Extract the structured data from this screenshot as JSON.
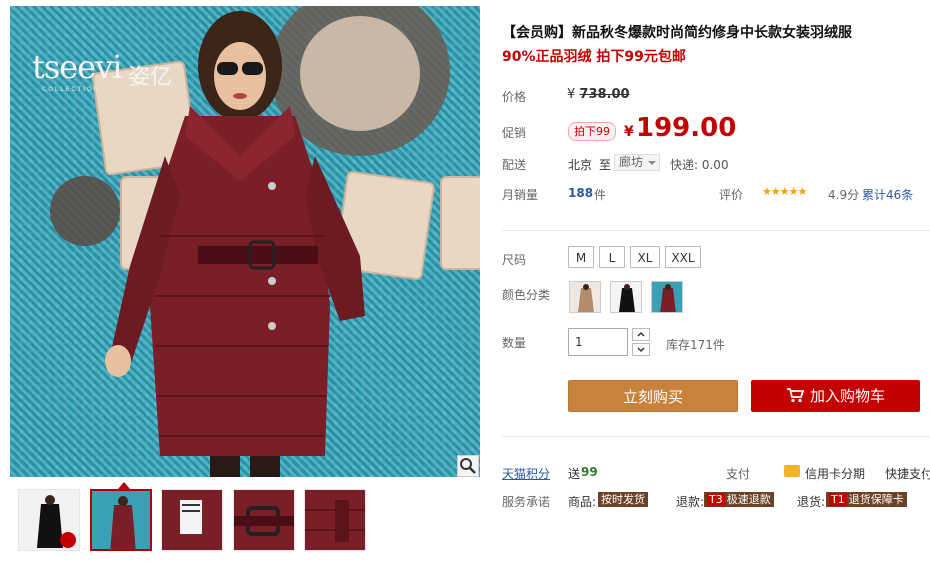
{
  "gallery": {
    "brand": "tseevi",
    "brand_cn": "姿亿",
    "brand_sub": "COLLECTION",
    "thumb_count": 5
  },
  "product": {
    "title": "【会员购】新品秋冬爆款时尚简约修身中长款女装羽绒服",
    "subtitle": "90%正品羽绒 拍下99元包邮"
  },
  "price": {
    "label": "价格",
    "original_symbol": "¥",
    "original": "738.00",
    "promo_label": "促销",
    "promo_tag": "拍下99",
    "symbol": "¥",
    "current": "199.00"
  },
  "shipping": {
    "label": "配送",
    "from": "北京",
    "to_word": "至",
    "city": "廊坊",
    "fee": "快递: 0.00"
  },
  "sales": {
    "label": "月销量",
    "count": "188",
    "unit": "件",
    "rating_label": "评价",
    "stars": "★★★★★",
    "score": "4.9分",
    "reviews": "累计46条"
  },
  "size": {
    "label": "尺码",
    "options": [
      "M",
      "L",
      "XL",
      "XXL"
    ]
  },
  "color": {
    "label": "颜色分类"
  },
  "quantity": {
    "label": "数量",
    "value": "1",
    "stock": "库存171件"
  },
  "actions": {
    "buy_now": "立刻购买",
    "add_cart": "加入购物车"
  },
  "points": {
    "label": "天猫积分",
    "prefix": "送",
    "value": "99"
  },
  "payment": {
    "label": "支付",
    "credit": "信用卡分期",
    "express": "快捷支付"
  },
  "service": {
    "label": "服务承诺",
    "goods_label": "商品:",
    "goods_tag": "按时发货",
    "refund_label": "退款:",
    "refund_code": "T3",
    "refund_tag": "极速退款",
    "return_label": "退货:",
    "return_code": "T1",
    "return_tag": "退货保障卡"
  },
  "colors": {
    "price_red": "#c40000",
    "buy_orange": "#c9823c",
    "link_blue": "#2a58a6"
  }
}
